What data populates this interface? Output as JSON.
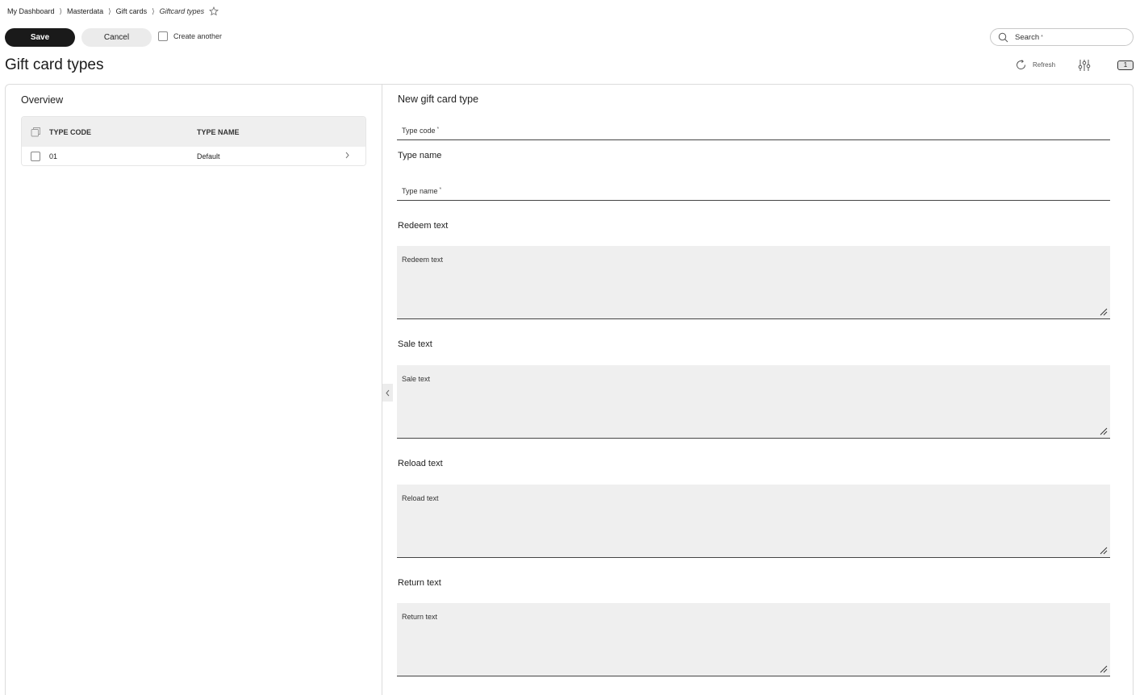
{
  "breadcrumb": {
    "items": [
      "My Dashboard",
      "Masterdata",
      "Gift cards"
    ],
    "current": "Giftcard types"
  },
  "toolbar": {
    "save_label": "Save",
    "cancel_label": "Cancel",
    "create_another_label": "Create another",
    "create_another_checked": false
  },
  "search": {
    "placeholder": "Search",
    "required_mark": "*"
  },
  "page": {
    "title": "Gift card types",
    "refresh_label": "Refresh",
    "count_badge": "1"
  },
  "overview": {
    "title": "Overview",
    "columns": [
      "TYPE CODE",
      "TYPE NAME"
    ],
    "rows": [
      {
        "type_code": "01",
        "type_name": "Default"
      }
    ]
  },
  "form": {
    "title": "New gift card type",
    "type_code_label": "Type code",
    "type_name_section": "Type name",
    "type_name_label": "Type name",
    "required_mark": "*",
    "redeem_section": "Redeem text",
    "redeem_placeholder": "Redeem text",
    "sale_section": "Sale text",
    "sale_placeholder": "Sale text",
    "reload_section": "Reload text",
    "reload_placeholder": "Reload text",
    "return_section": "Return text",
    "return_placeholder": "Return text"
  },
  "icons": {
    "star": "star-icon",
    "search": "search-icon",
    "refresh": "refresh-icon",
    "filter": "sliders-icon",
    "collapse": "chevron-left-icon",
    "row_open": "chevron-right-icon",
    "resize": "resize-grip-icon"
  }
}
